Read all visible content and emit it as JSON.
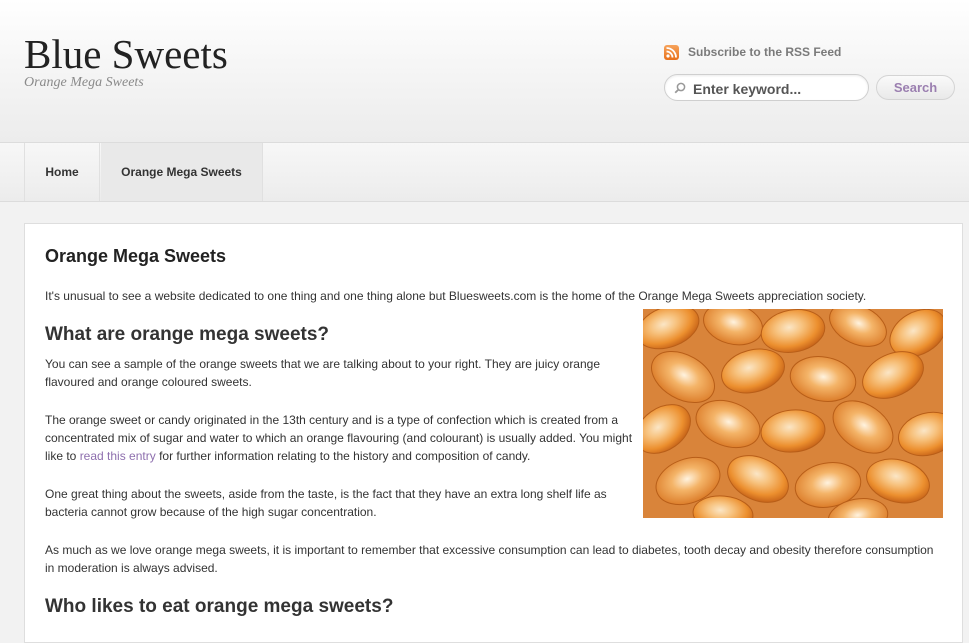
{
  "header": {
    "site_title": "Blue Sweets",
    "tagline": "Orange Mega Sweets",
    "rss_label": "Subscribe to the RSS Feed",
    "search": {
      "placeholder": "Enter keyword...",
      "button_label": "Search"
    }
  },
  "nav": {
    "items": [
      {
        "label": "Home"
      },
      {
        "label": "Orange Mega Sweets"
      }
    ]
  },
  "article": {
    "title": "Orange Mega Sweets",
    "intro": "It's unusual to see a website dedicated to one thing and one thing alone but Bluesweets.com is the home of the Orange Mega Sweets appreciation society.",
    "heading_1": "What are orange mega sweets?",
    "para_1": "You can see a sample of the orange sweets that we are talking about to your right. They are juicy orange flavoured and orange coloured sweets.",
    "para_2_before": "The orange sweet or candy originated in the 13th century and is a type of confection which is created from a concentrated mix of sugar and water to which an orange flavouring (and colourant) is usually added. You might like to ",
    "para_2_link": "read this entry",
    "para_2_after": " for further information relating to the history and composition of candy.",
    "para_3": "One great thing about the sweets, aside from the taste, is the fact that they have an extra long shelf life as bacteria cannot grow because of the high sugar concentration.",
    "para_4": "As much as we love orange mega sweets, it is important to remember that excessive consumption can lead to diabetes, tooth decay and obesity therefore consumption in moderation is always advised.",
    "heading_2": "Who likes to eat orange mega sweets?"
  },
  "icons": {
    "rss": "rss-feed-icon",
    "search": "search-icon"
  },
  "colors": {
    "link": "#8e6fae",
    "rss": "#e8701a",
    "photo_base": "#e9a35c"
  }
}
